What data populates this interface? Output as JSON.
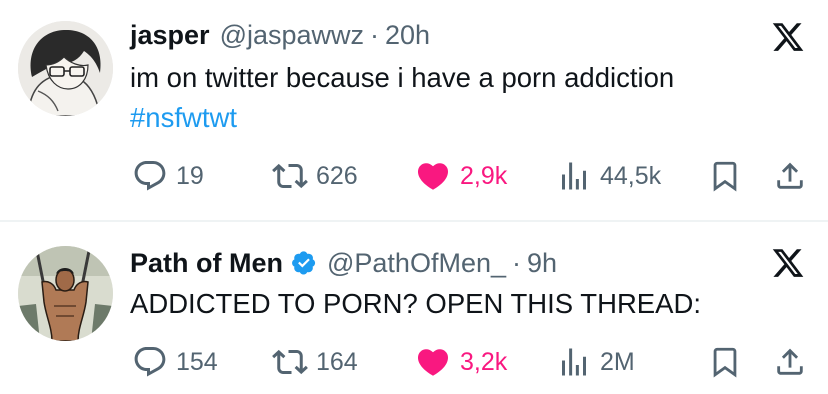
{
  "tweets": [
    {
      "author_name": "jasper",
      "handle": "@jaspawwz",
      "separator": "·",
      "time": "20h",
      "text_line_1": "im on twitter because i have a porn addiction",
      "hashtag": "#nsfwtwt",
      "verified": false,
      "stats": {
        "replies": "19",
        "retweets": "626",
        "likes": "2,9k",
        "views": "44,5k"
      },
      "liked": true,
      "icons": {
        "reply": "comment-icon",
        "retweet": "retweet-icon",
        "like": "heart-icon",
        "views": "analytics-icon",
        "bookmark": "bookmark-icon",
        "share": "share-icon",
        "source": "x-logo-icon"
      }
    },
    {
      "author_name": "Path of Men",
      "handle": "@PathOfMen_",
      "separator": "·",
      "time": "9h",
      "text_line_1": "ADDICTED TO PORN? OPEN THIS THREAD:",
      "verified": true,
      "stats": {
        "replies": "154",
        "retweets": "164",
        "likes": "3,2k",
        "views": "2M"
      },
      "liked": true,
      "icons": {
        "reply": "comment-icon",
        "retweet": "retweet-icon",
        "like": "heart-icon",
        "views": "analytics-icon",
        "bookmark": "bookmark-icon",
        "share": "share-icon",
        "source": "x-logo-icon"
      }
    }
  ],
  "colors": {
    "text_primary": "#0f1419",
    "text_secondary": "#536471",
    "link": "#1d9bf0",
    "like": "#f91880",
    "verified": "#1d9bf0",
    "divider": "#eff3f4"
  }
}
